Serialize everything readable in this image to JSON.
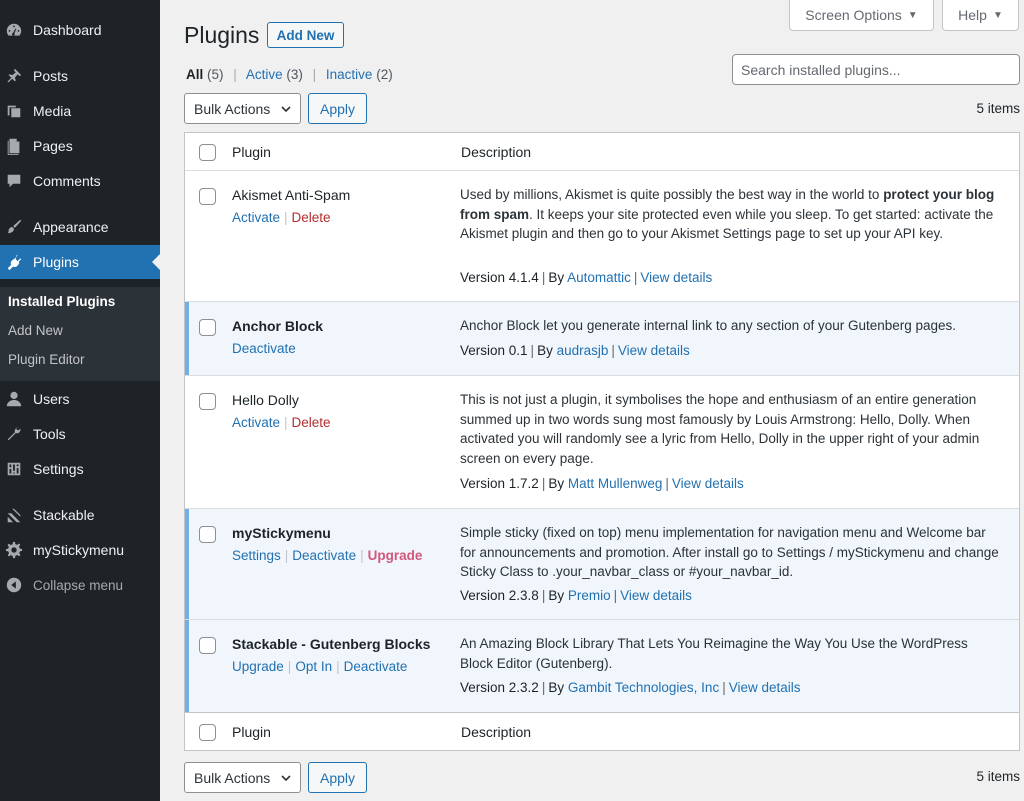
{
  "sidebar": {
    "items": [
      {
        "label": "Dashboard",
        "icon": "dashboard-icon"
      },
      {
        "label": "Posts",
        "icon": "pin-icon"
      },
      {
        "label": "Media",
        "icon": "media-icon"
      },
      {
        "label": "Pages",
        "icon": "pages-icon"
      },
      {
        "label": "Comments",
        "icon": "comments-icon"
      },
      {
        "label": "Appearance",
        "icon": "paintbrush-icon"
      },
      {
        "label": "Plugins",
        "icon": "plugin-icon"
      },
      {
        "label": "Users",
        "icon": "users-icon"
      },
      {
        "label": "Tools",
        "icon": "wrench-icon"
      },
      {
        "label": "Settings",
        "icon": "settings-icon"
      },
      {
        "label": "Stackable",
        "icon": "stackable-icon"
      },
      {
        "label": "myStickymenu",
        "icon": "gear-icon"
      },
      {
        "label": "Collapse menu",
        "icon": "collapse-icon"
      }
    ],
    "submenu": [
      "Installed Plugins",
      "Add New",
      "Plugin Editor"
    ]
  },
  "top_buttons": {
    "screen_options": "Screen Options",
    "help": "Help"
  },
  "header": {
    "title": "Plugins",
    "add_new": "Add New"
  },
  "filters": {
    "all": "All",
    "all_count": "(5)",
    "active": "Active",
    "active_count": "(3)",
    "inactive": "Inactive",
    "inactive_count": "(2)"
  },
  "search": {
    "placeholder": "Search installed plugins..."
  },
  "bulk": {
    "label": "Bulk Actions",
    "apply": "Apply",
    "items": "5 items"
  },
  "table": {
    "col_plugin": "Plugin",
    "col_description": "Description",
    "rows": [
      {
        "name": "Akismet Anti-Spam",
        "actions": [
          "Activate",
          "Delete"
        ],
        "desc_pre": "Used by millions, Akismet is quite possibly the best way in the world to ",
        "desc_bold": "protect your blog from spam",
        "desc_post": ". It keeps your site protected even while you sleep. To get started: activate the Akismet plugin and then go to your Akismet Settings page to set up your API key.",
        "version": "Version 4.1.4",
        "by": "By",
        "author": "Automattic",
        "details": "View details"
      },
      {
        "name": "Anchor Block",
        "actions": [
          "Deactivate"
        ],
        "desc_pre": "Anchor Block let you generate internal link to any section of your Gutenberg pages.",
        "version": "Version 0.1",
        "by": "By",
        "author": "audrasjb",
        "details": "View details"
      },
      {
        "name": "Hello Dolly",
        "actions": [
          "Activate",
          "Delete"
        ],
        "desc_pre": "This is not just a plugin, it symbolises the hope and enthusiasm of an entire generation summed up in two words sung most famously by Louis Armstrong: Hello, Dolly. When activated you will randomly see a lyric from Hello, Dolly in the upper right of your admin screen on every page.",
        "version": "Version 1.7.2",
        "by": "By",
        "author": "Matt Mullenweg",
        "details": "View details"
      },
      {
        "name": "myStickymenu",
        "actions": [
          "Settings",
          "Deactivate",
          "Upgrade"
        ],
        "desc_pre": "Simple sticky (fixed on top) menu implementation for navigation menu and Welcome bar for announcements and promotion. After install go to Settings / myStickymenu and change Sticky Class to .your_navbar_class or #your_navbar_id.",
        "version": "Version 2.3.8",
        "by": "By",
        "author": "Premio",
        "details": "View details"
      },
      {
        "name": "Stackable - Gutenberg Blocks",
        "actions": [
          "Upgrade",
          "Opt In",
          "Deactivate"
        ],
        "desc_pre": "An Amazing Block Library That Lets You Reimagine the Way You Use the WordPress Block Editor (Gutenberg).",
        "version": "Version 2.3.2",
        "by": "By",
        "author": "Gambit Technologies, Inc",
        "details": "View details"
      }
    ]
  },
  "colors": {
    "sidebar_bg": "#1d2327",
    "accent": "#2271b1",
    "active_row": "#f0f6fc",
    "active_border": "#72aee6",
    "delete": "#b32d2e",
    "upgrade": "#d5567b"
  }
}
